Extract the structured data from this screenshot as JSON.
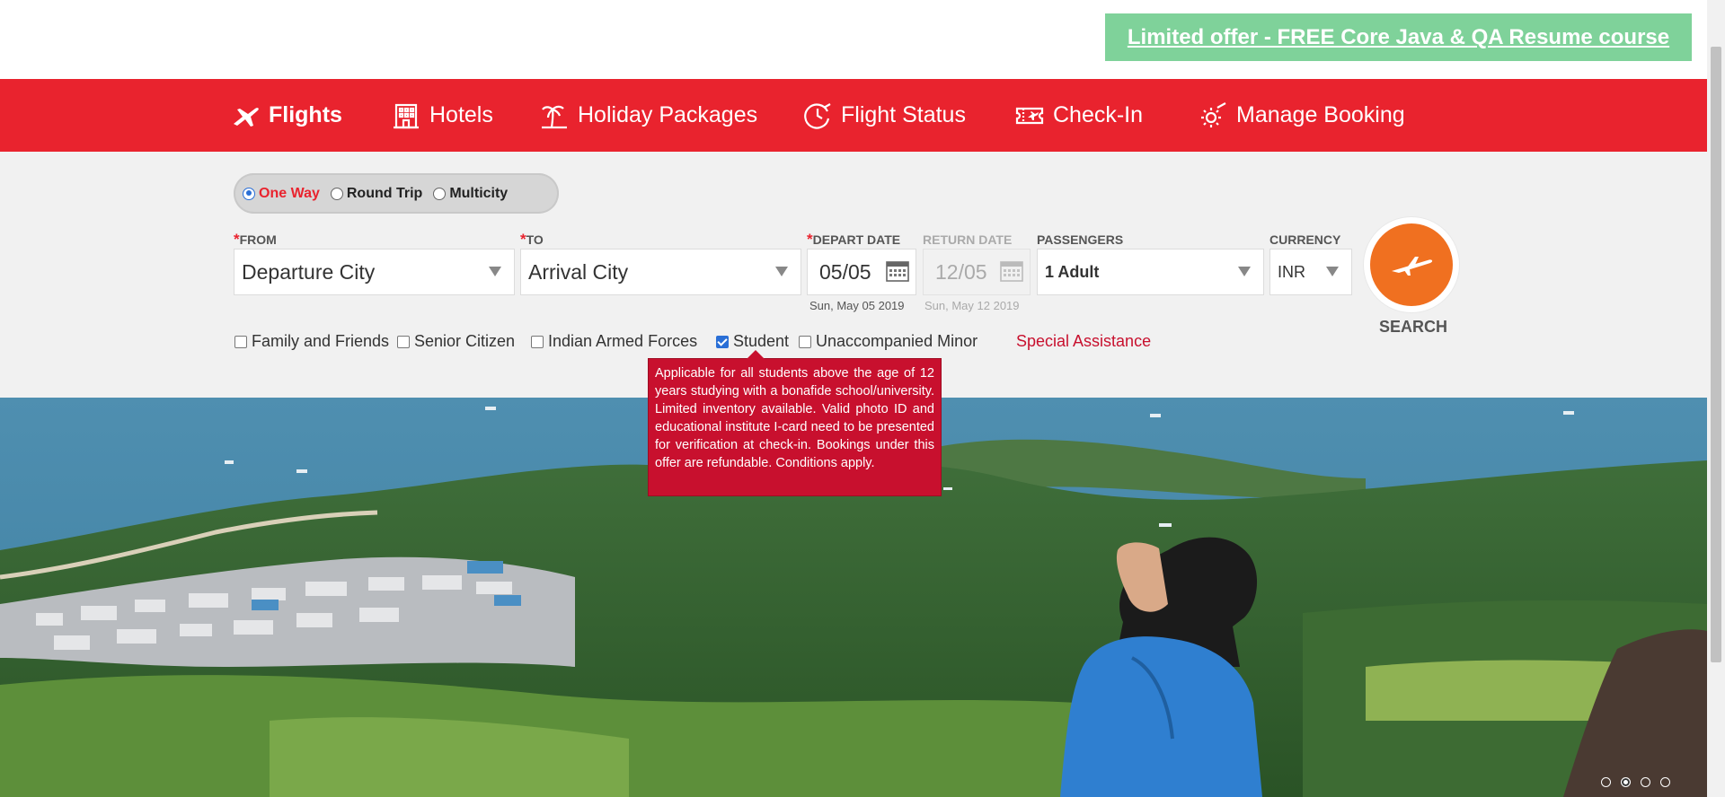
{
  "offer": {
    "text": "Limited offer - FREE Core Java & QA Resume course"
  },
  "nav": {
    "items": [
      {
        "label": "Flights",
        "icon": "plane-icon"
      },
      {
        "label": "Hotels",
        "icon": "hotel-icon"
      },
      {
        "label": "Holiday Packages",
        "icon": "palm-tree-icon"
      },
      {
        "label": "Flight Status",
        "icon": "clock-plane-icon"
      },
      {
        "label": "Check-In",
        "icon": "ticket-icon"
      },
      {
        "label": "Manage Booking",
        "icon": "gear-plane-icon"
      }
    ]
  },
  "trip": {
    "options": [
      {
        "label": "One Way",
        "selected": true
      },
      {
        "label": "Round Trip",
        "selected": false
      },
      {
        "label": "Multicity",
        "selected": false
      }
    ]
  },
  "form": {
    "from": {
      "label": "FROM",
      "value": "Departure City"
    },
    "to": {
      "label": "TO",
      "value": "Arrival City"
    },
    "depart": {
      "label": "DEPART DATE",
      "value": "05/05",
      "sub": "Sun, May 05 2019"
    },
    "return": {
      "label": "RETURN DATE",
      "value": "12/05",
      "sub": "Sun, May 12 2019"
    },
    "passengers": {
      "label": "PASSENGERS",
      "value": "1 Adult"
    },
    "currency": {
      "label": "CURRENCY",
      "value": "INR"
    },
    "search_label": "SEARCH"
  },
  "concessions": {
    "items": [
      {
        "label": "Family and Friends",
        "checked": false
      },
      {
        "label": "Senior Citizen",
        "checked": false
      },
      {
        "label": "Indian Armed Forces",
        "checked": false
      },
      {
        "label": "Student",
        "checked": true
      },
      {
        "label": "Unaccompanied Minor",
        "checked": false
      }
    ],
    "special_assistance": "Special Assistance",
    "tooltip": "Applicable for all students above the age of 12 years studying with a bonafide school/university. Limited inventory available. Valid photo ID and educational institute I-card need to be presented for verification at check-in. Bookings under this offer are refundable. Conditions apply."
  },
  "carousel": {
    "active_index": 1,
    "count": 4
  },
  "colors": {
    "brand_red": "#e9232e",
    "search_orange": "#f07020",
    "offer_green": "#7fd29a"
  }
}
